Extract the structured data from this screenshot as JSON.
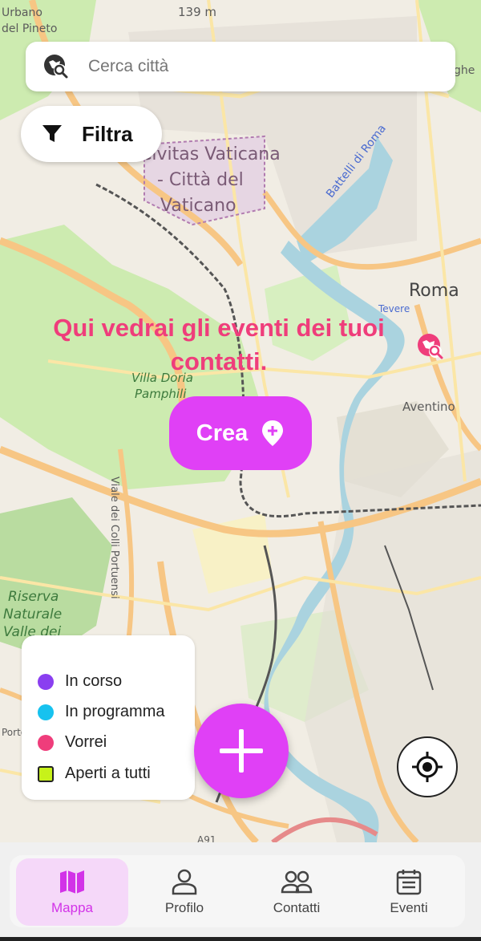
{
  "map": {
    "labels": {
      "urbano": "Urbano",
      "pineto": "del Pineto",
      "elevation": "139 m",
      "civitas": "Civitas Vaticana",
      "citta": "- Città del",
      "vaticano": "Vaticano",
      "battelli": "Battelli di Roma",
      "roma": "Roma",
      "tevere": "Tevere",
      "aventino": "Aventino",
      "villa": "Villa Doria",
      "pamphili": "Pamphili",
      "viale": "Viale dei Colli Portuensi",
      "riserva": "Riserva",
      "naturale": "Naturale",
      "valle": "Valle dei",
      "porto": "Porto",
      "a91": "A91",
      "ghe": "ghe"
    },
    "colors": {
      "base": "#f1ede4",
      "green": "#cdebb0",
      "river": "#aad3df",
      "road_major": "#f7c684",
      "road_minor": "#fbe6a6"
    }
  },
  "search": {
    "placeholder": "Cerca città",
    "icon": "search-location-icon"
  },
  "filter": {
    "label": "Filtra",
    "icon": "funnel-icon"
  },
  "empty_message": "Qui vedrai gli eventi dei tuoi contatti.",
  "create_button": {
    "label": "Crea",
    "icon": "location-pin-plus-icon"
  },
  "legend": {
    "items": [
      {
        "label": "In corso",
        "color": "#8a3ff0",
        "shape": "circle"
      },
      {
        "label": "In programma",
        "color": "#17c2ef",
        "shape": "circle"
      },
      {
        "label": "Vorrei",
        "color": "#ef3d7b",
        "shape": "circle"
      },
      {
        "label": "Aperti a tutti",
        "color": "#c7f21a",
        "shape": "square"
      }
    ]
  },
  "fab": {
    "icon": "plus-icon"
  },
  "gps_button": {
    "icon": "crosshair-icon"
  },
  "bottom_nav": {
    "items": [
      {
        "label": "Mappa",
        "icon": "map-icon",
        "active": true
      },
      {
        "label": "Profilo",
        "icon": "person-icon",
        "active": false
      },
      {
        "label": "Contatti",
        "icon": "people-icon",
        "active": false
      },
      {
        "label": "Eventi",
        "icon": "calendar-icon",
        "active": false
      }
    ],
    "accent": "#d232e8"
  }
}
